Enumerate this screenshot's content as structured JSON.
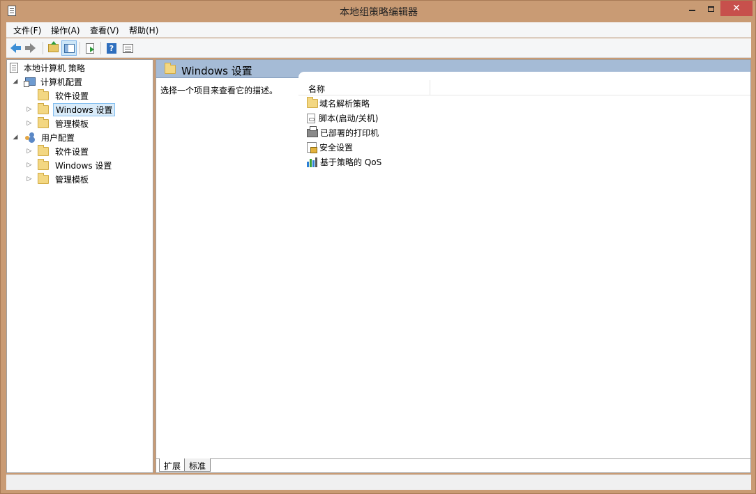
{
  "window": {
    "title": "本地组策略编辑器"
  },
  "menu": {
    "items": [
      "文件(F)",
      "操作(A)",
      "查看(V)",
      "帮助(H)"
    ]
  },
  "toolbar": {
    "buttons": [
      "back-icon",
      "forward-icon",
      "up-folder-icon",
      "show-hide-tree-icon",
      "export-list-icon",
      "help-icon",
      "properties-icon"
    ]
  },
  "tree": {
    "root": "本地计算机 策略",
    "computer_config": "计算机配置",
    "computer_children": [
      "软件设置",
      "Windows 设置",
      "管理模板"
    ],
    "user_config": "用户配置",
    "user_children": [
      "软件设置",
      "Windows 设置",
      "管理模板"
    ],
    "selected": "Windows 设置"
  },
  "right": {
    "header_title": "Windows 设置",
    "description": "选择一个项目来查看它的描述。",
    "column_name": "名称",
    "items": [
      "域名解析策略",
      "脚本(启动/关机)",
      "已部署的打印机",
      "安全设置",
      "基于策略的 QoS"
    ]
  },
  "tabs": [
    "扩展",
    "标准"
  ],
  "colors": {
    "frame": "#c99b74",
    "header": "#a5bbd6",
    "close": "#c7504c"
  }
}
